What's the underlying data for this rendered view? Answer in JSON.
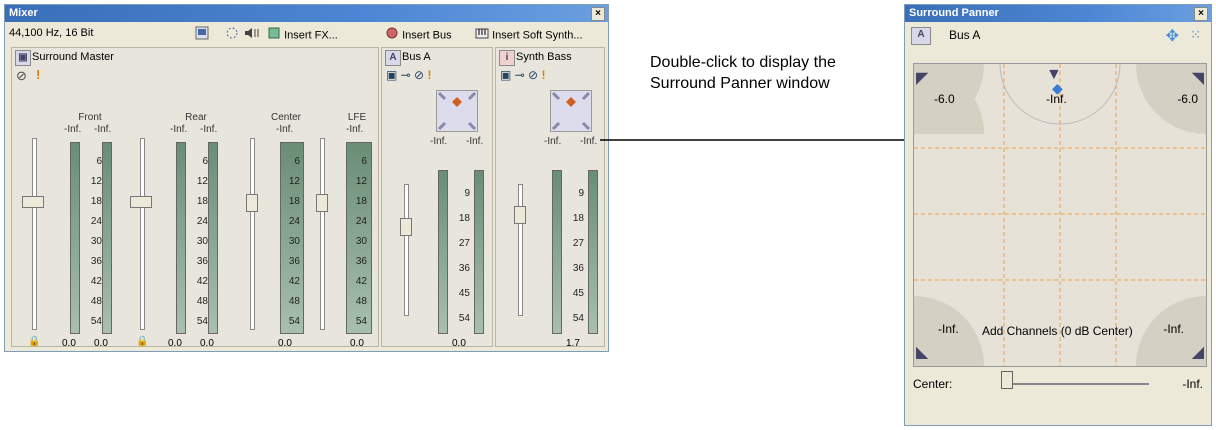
{
  "mixer": {
    "title": "Mixer",
    "format": "44,100 Hz, 16 Bit",
    "toolbar": {
      "insert_fx": "Insert FX...",
      "insert_bus": "Insert Bus",
      "insert_soft_synth": "Insert Soft Synth..."
    },
    "master": {
      "name": "Surround Master",
      "groups": [
        {
          "label": "Front",
          "left": "-Inf.",
          "right": "-Inf.",
          "val_left": "0.0",
          "val_right": "0.0"
        },
        {
          "label": "Rear",
          "left": "-Inf.",
          "right": "-Inf.",
          "val_left": "0.0",
          "val_right": "0.0"
        },
        {
          "label": "Center",
          "top": "-Inf.",
          "val": "0.0"
        },
        {
          "label": "LFE",
          "top": "-Inf.",
          "val": "0.0"
        }
      ]
    },
    "busA": {
      "name": "Bus A",
      "left": "-Inf.",
      "right": "-Inf.",
      "val": "0.0"
    },
    "synth": {
      "name": "Synth Bass",
      "left": "-Inf.",
      "right": "-Inf.",
      "val": "1.7"
    },
    "scale_master": [
      "6",
      "12",
      "18",
      "24",
      "30",
      "36",
      "42",
      "48",
      "54"
    ],
    "scale_bus": [
      "9",
      "18",
      "27",
      "36",
      "45",
      "54"
    ]
  },
  "annotation": "Double-click to display the Surround Panner window",
  "panner": {
    "title": "Surround Panner",
    "bus": "Bus A",
    "front_left": "-6.0",
    "front_center": "-Inf.",
    "front_right": "-6.0",
    "rear_left": "-Inf.",
    "rear_right": "-Inf.",
    "add_channels": "Add Channels (0 dB Center)",
    "center_label": "Center:",
    "center_value": "-Inf."
  },
  "colors": {
    "title": "#3a6fb8",
    "meter": "#7a9c86",
    "grid": "#f0a050"
  }
}
